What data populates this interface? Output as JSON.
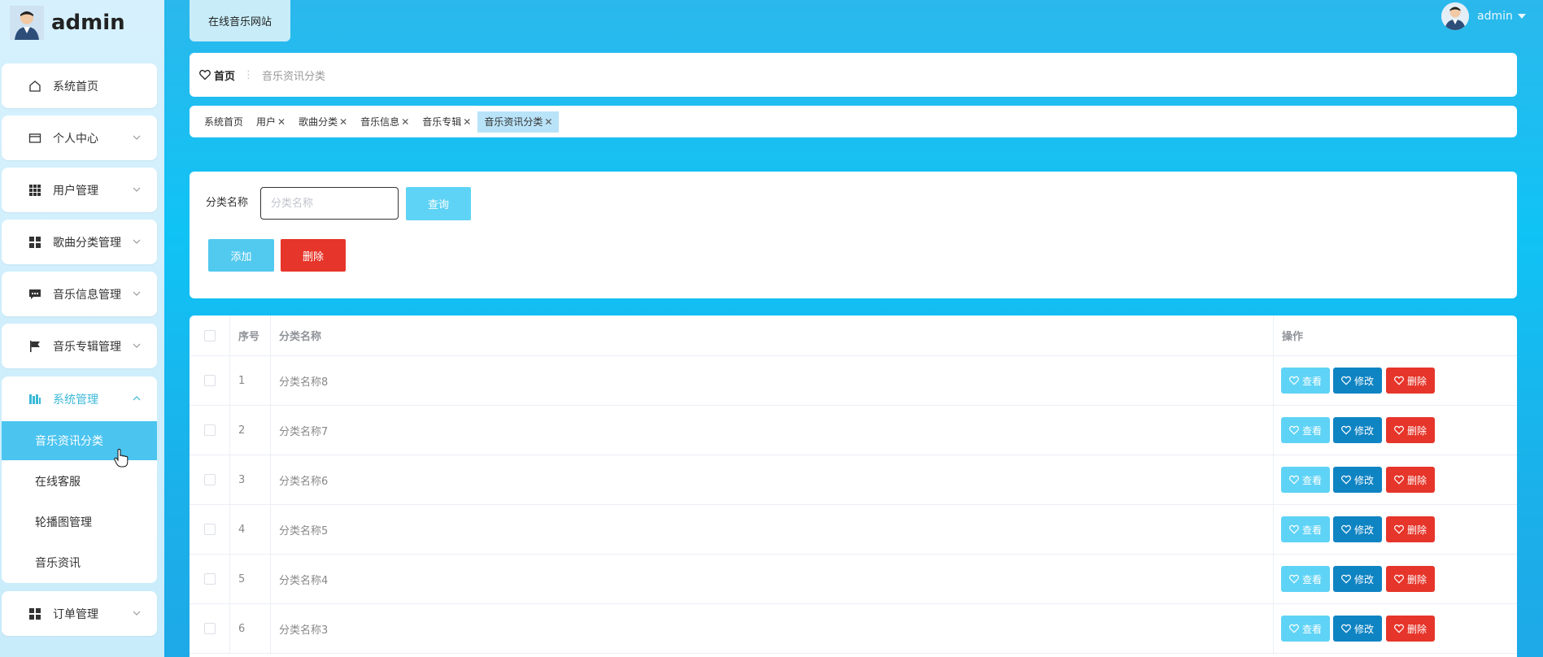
{
  "app": {
    "brand": "admin",
    "site_link": "在线音乐网站",
    "user": "admin"
  },
  "sidebar": {
    "items": [
      {
        "label": "系统首页",
        "icon": "home-icon"
      },
      {
        "label": "个人中心",
        "icon": "card-icon"
      },
      {
        "label": "用户管理",
        "icon": "grid-icon"
      },
      {
        "label": "歌曲分类管理",
        "icon": "apps-icon"
      },
      {
        "label": "音乐信息管理",
        "icon": "message-icon"
      },
      {
        "label": "音乐专辑管理",
        "icon": "flag-icon"
      },
      {
        "label": "系统管理",
        "icon": "columns-icon"
      },
      {
        "label": "订单管理",
        "icon": "apps-icon"
      }
    ],
    "submenu": [
      {
        "label": "音乐资讯分类"
      },
      {
        "label": "在线客服"
      },
      {
        "label": "轮播图管理"
      },
      {
        "label": "音乐资讯"
      }
    ]
  },
  "breadcrumb": {
    "home": "首页",
    "separator": "⋮",
    "current": "音乐资讯分类"
  },
  "tags": [
    {
      "label": "系统首页",
      "closable": false
    },
    {
      "label": "用户",
      "closable": true
    },
    {
      "label": "歌曲分类",
      "closable": true
    },
    {
      "label": "音乐信息",
      "closable": true
    },
    {
      "label": "音乐专辑",
      "closable": true
    },
    {
      "label": "音乐资讯分类",
      "closable": true,
      "active": true
    }
  ],
  "search": {
    "label": "分类名称",
    "placeholder": "分类名称",
    "query_label": "查询",
    "add_label": "添加",
    "delete_label": "删除"
  },
  "table": {
    "headers": {
      "index": "序号",
      "name": "分类名称",
      "ops": "操作"
    },
    "rows": [
      {
        "index": "1",
        "name": "分类名称8"
      },
      {
        "index": "2",
        "name": "分类名称7"
      },
      {
        "index": "3",
        "name": "分类名称6"
      },
      {
        "index": "4",
        "name": "分类名称5"
      },
      {
        "index": "5",
        "name": "分类名称4"
      },
      {
        "index": "6",
        "name": "分类名称3"
      }
    ],
    "actions": {
      "view": "查看",
      "edit": "修改",
      "delete": "删除"
    }
  },
  "colors": {
    "accent": "#5fd3f5",
    "primary": "#0f84c3",
    "danger": "#e6352a",
    "active_menu": "#4bc4f0"
  }
}
